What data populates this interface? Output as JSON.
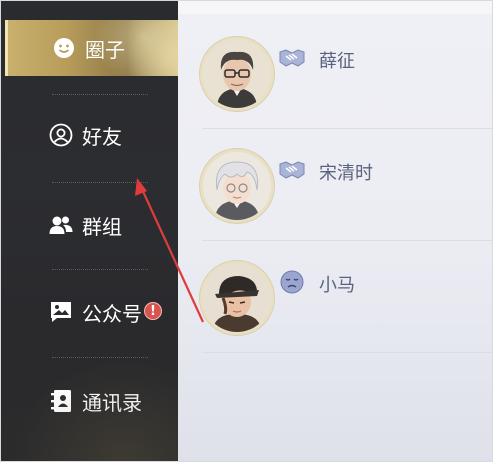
{
  "sidebar": {
    "items": [
      {
        "label": "圈子",
        "icon": "smiley-bubble-icon",
        "active": true
      },
      {
        "label": "好友",
        "icon": "friend-avatar-icon",
        "active": false
      },
      {
        "label": "群组",
        "icon": "group-people-icon",
        "active": false
      },
      {
        "label": "公众号",
        "icon": "image-bubble-icon",
        "active": false,
        "badge": "!"
      },
      {
        "label": "通讯录",
        "icon": "address-book-icon",
        "active": false
      }
    ]
  },
  "contacts": [
    {
      "name": "薛征",
      "relation_icon": "handshake-icon"
    },
    {
      "name": "宋清时",
      "relation_icon": "handshake-icon"
    },
    {
      "name": "小马",
      "relation_icon": "sad-face-icon"
    }
  ],
  "colors": {
    "active_gold": "#c9b06d",
    "sidebar_bg": "#2b2c30",
    "badge_red": "#d9534f",
    "name_text": "#5b6280",
    "annotation_red": "#e03c3c"
  }
}
